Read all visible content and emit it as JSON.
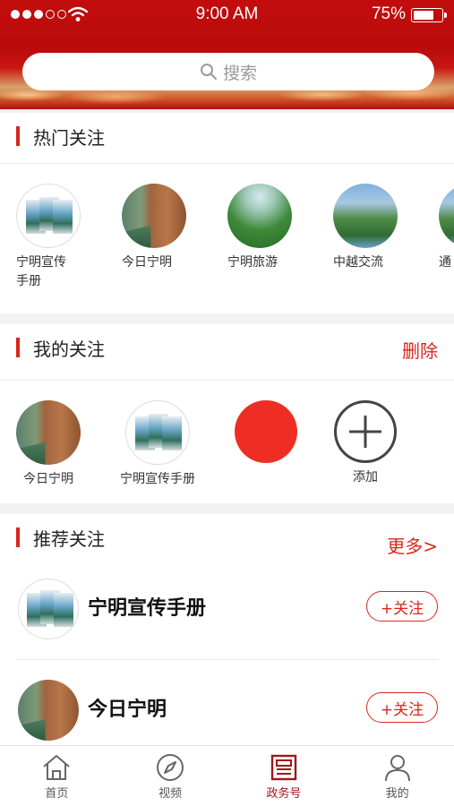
{
  "status_bar": {
    "time": "9:00 AM",
    "battery": "75%",
    "battery_level": 0.75
  },
  "search": {
    "placeholder": "搜索"
  },
  "hot": {
    "title": "热门关注",
    "items": [
      {
        "label": "宁明宣传\n手册",
        "icon": "brochure"
      },
      {
        "label": "今日宁明",
        "icon": "cliff"
      },
      {
        "label": "宁明旅游",
        "icon": "green-valley"
      },
      {
        "label": "中越交流",
        "icon": "river-valley"
      },
      {
        "label": "通",
        "icon": "river-valley"
      }
    ]
  },
  "mine": {
    "title": "我的关注",
    "action": "删除",
    "items": [
      {
        "label": "今日宁明",
        "icon": "cliff"
      },
      {
        "label": "宁明宣传手册",
        "icon": "brochure"
      },
      {
        "label": "",
        "icon": "red-dot"
      },
      {
        "label": "添加",
        "icon": "add"
      }
    ]
  },
  "recommend": {
    "title": "推荐关注",
    "action": "更多>",
    "rows": [
      {
        "name": "宁明宣传手册",
        "button": "+关注",
        "icon": "brochure"
      },
      {
        "name": "今日宁明",
        "button": "+关注",
        "icon": "cliff"
      }
    ]
  },
  "tabbar": {
    "tabs": [
      {
        "label": "首页",
        "icon": "home-icon"
      },
      {
        "label": "视频",
        "icon": "compass-icon"
      },
      {
        "label": "政务号",
        "icon": "newspaper-icon",
        "active": true
      },
      {
        "label": "我的",
        "icon": "user-icon"
      }
    ]
  },
  "colors": {
    "accent": "#d9261c",
    "header": "#c30d0d",
    "active_tab": "#a3151b"
  }
}
